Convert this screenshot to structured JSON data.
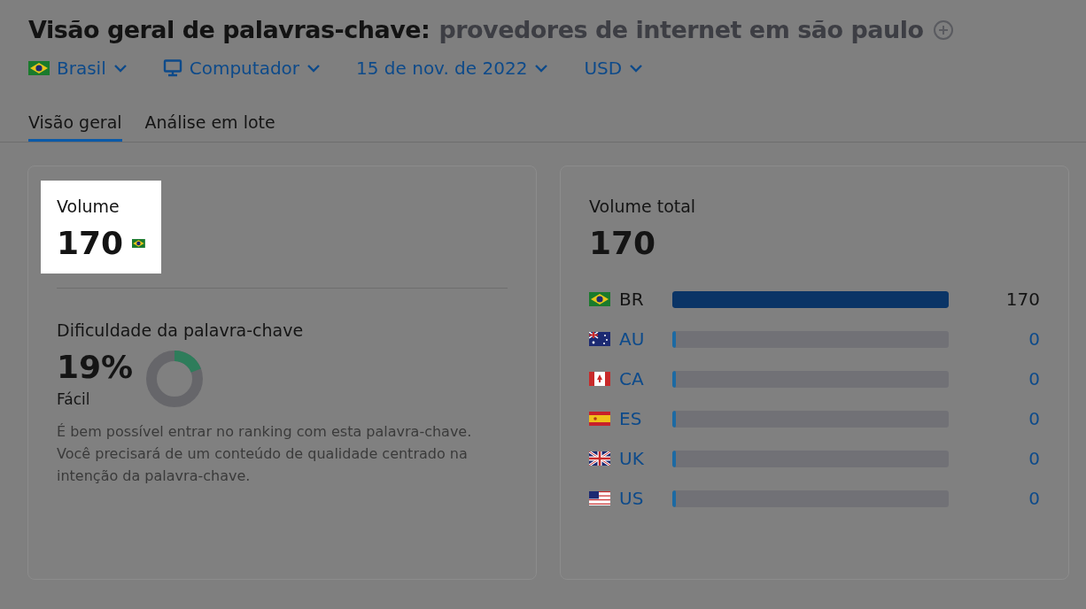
{
  "header": {
    "title": "Visão geral de palavras-chave:",
    "keyword": "provedores de internet em são paulo"
  },
  "filters": [
    {
      "kind": "flag",
      "label": "Brasil"
    },
    {
      "kind": "device",
      "label": "Computador"
    },
    {
      "kind": "plain",
      "label": "15 de nov. de 2022"
    },
    {
      "kind": "plain",
      "label": "USD"
    }
  ],
  "tabs": [
    {
      "label": "Visão geral",
      "selected": true
    },
    {
      "label": "Análise em lote",
      "selected": false
    }
  ],
  "volume_card": {
    "label": "Volume",
    "value": "170"
  },
  "difficulty": {
    "label": "Dificuldade da palavra-chave",
    "value": "19%",
    "rating": "Fácil",
    "level": 0.19,
    "color": "#2e7d5b",
    "description": "É bem possível entrar no ranking com esta palavra-chave. Você precisará de um conteúdo de qualidade centrado na intenção da palavra-chave."
  },
  "total_card": {
    "label": "Volume total",
    "value": "170",
    "countries": [
      {
        "kind": "br",
        "code": "BR",
        "count": "170",
        "selected": true,
        "level": 1
      },
      {
        "kind": "au",
        "code": "AU",
        "count": "0",
        "selected": false,
        "level": 0.01
      },
      {
        "kind": "ca",
        "code": "CA",
        "count": "0",
        "selected": false,
        "level": 0.01
      },
      {
        "kind": "es",
        "code": "ES",
        "count": "0",
        "selected": false,
        "level": 0.01
      },
      {
        "kind": "uk",
        "code": "UK",
        "count": "0",
        "selected": false,
        "level": 0.01
      },
      {
        "kind": "us",
        "code": "US",
        "count": "0",
        "selected": false,
        "level": 0.01
      }
    ]
  }
}
